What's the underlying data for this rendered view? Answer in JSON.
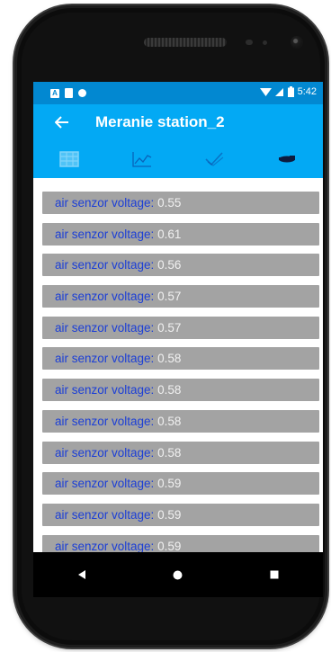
{
  "status_bar": {
    "left_icons": [
      "a-notification-icon",
      "document-notification-icon",
      "circle-notification-icon"
    ],
    "a_glyph": "A",
    "time": "5:42"
  },
  "app_bar": {
    "title": "Meranie station_2",
    "back_icon": "arrow-left-icon"
  },
  "tabs": [
    {
      "name": "tab-table",
      "icon": "table-icon",
      "active": true
    },
    {
      "name": "tab-chart",
      "icon": "line-chart-icon",
      "active": false
    },
    {
      "name": "tab-check",
      "icon": "checkmark-icon",
      "active": false
    },
    {
      "name": "tab-sensor",
      "icon": "sensor-icon",
      "active": false
    }
  ],
  "measurements": [
    {
      "label": "air senzor voltage:",
      "value": "0.55"
    },
    {
      "label": "air senzor voltage:",
      "value": "0.61"
    },
    {
      "label": "air senzor voltage:",
      "value": "0.56"
    },
    {
      "label": "air senzor voltage:",
      "value": "0.57"
    },
    {
      "label": "air senzor voltage:",
      "value": "0.57"
    },
    {
      "label": "air senzor voltage:",
      "value": "0.58"
    },
    {
      "label": "air senzor voltage:",
      "value": "0.58"
    },
    {
      "label": "air senzor voltage:",
      "value": "0.58"
    },
    {
      "label": "air senzor voltage:",
      "value": "0.58"
    },
    {
      "label": "air senzor voltage:",
      "value": "0.59"
    },
    {
      "label": "air senzor voltage:",
      "value": "0.59"
    },
    {
      "label": "air senzor voltage:",
      "value": "0.59"
    }
  ],
  "nav": [
    {
      "name": "nav-back-button",
      "icon": "triangle-back-icon"
    },
    {
      "name": "nav-home-button",
      "icon": "circle-home-icon"
    },
    {
      "name": "nav-recents-button",
      "icon": "square-recents-icon"
    }
  ],
  "colors": {
    "status_bar": "#0288d1",
    "app_bar": "#03a9f4",
    "row_background": "#a3a3a3",
    "label_text": "#1c3fd6",
    "value_text": "#f0f0f0"
  }
}
